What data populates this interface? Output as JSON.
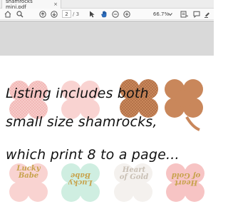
{
  "tab": {
    "title": "shamrocks mini.pdf",
    "close": "×"
  },
  "toolbar": {
    "current_page": "2",
    "total_pages": "/ 3",
    "zoom": "66.7%",
    "icons": [
      "home-icon",
      "search-icon",
      "page-up-icon",
      "page-down-icon",
      "cursor-icon",
      "hand-icon",
      "zoom-out-icon",
      "zoom-in-icon",
      "zoom-dropdown-icon",
      "fit-icon",
      "scroll-icon",
      "comment-icon",
      "highlight-icon"
    ]
  },
  "overlay": {
    "line1": "Listing includes both",
    "line2": "small size shamrocks,",
    "line3": "which print 8 to a page..."
  },
  "shamrock_labels": {
    "one": "Lucky\nBabe",
    "two": "Lucky\nBabe",
    "three": "Heart\nof Gold",
    "four": "Heart\nof Gold"
  },
  "colors": {
    "pink": "#f7cbc8",
    "pink_dots": "#e99ea0",
    "mint": "#cfeee1",
    "brown": "#c9875b",
    "brown_dots": "#9a5a33",
    "gold": "#c7a24b"
  }
}
